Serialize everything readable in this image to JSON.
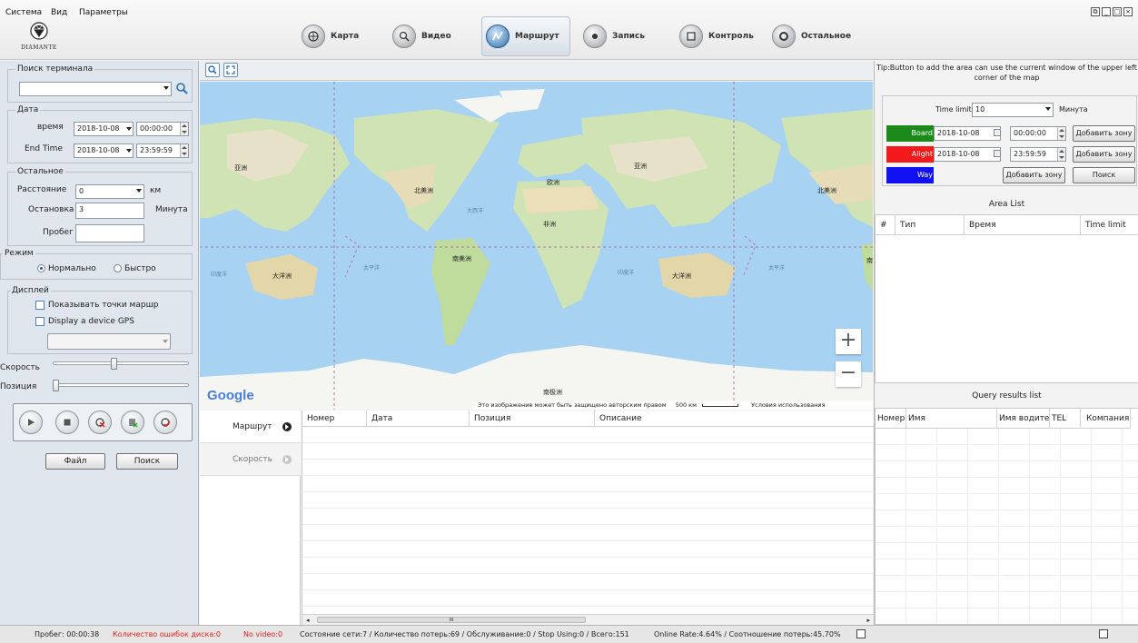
{
  "menu": [
    "Система",
    "Вид",
    "Параметры"
  ],
  "logo_text": "DIAMANTE",
  "nav_tabs": [
    {
      "label": "Карта",
      "icon": "map-icon"
    },
    {
      "label": "Видео",
      "icon": "video-icon"
    },
    {
      "label": "Маршрут",
      "icon": "route-icon",
      "active": true
    },
    {
      "label": "Запись",
      "icon": "record-icon"
    },
    {
      "label": "Контроль",
      "icon": "control-icon"
    },
    {
      "label": "Остальное",
      "icon": "other-icon"
    }
  ],
  "left": {
    "search_legend": "Поиск терминала",
    "search_value": "",
    "date_legend": "Дата",
    "start_time_label": "время",
    "start_date": "2018-10-08",
    "start_time": "00:00:00",
    "end_time_label": "End Time",
    "end_date": "2018-10-08",
    "end_time": "23:59:59",
    "other_legend": "Остальное",
    "distance_label": "Расстояние",
    "distance_value": "0",
    "distance_unit": "км",
    "stop_label": "Остановка",
    "stop_value": "3",
    "stop_unit": "Минута",
    "mileage_label": "Пробег",
    "mileage_value": "",
    "mode_legend": "Режим",
    "mode_normal": "Нормально",
    "mode_fast": "Быстро",
    "display_legend": "Дисплей",
    "show_route_points": "Показывать точки маршр",
    "display_gps": "Display a device GPS",
    "device_select": "",
    "speed_label": "Скорость",
    "speed_level": 0.45,
    "position_label": "Позиция",
    "position_level": 0.0,
    "file_button": "Файл",
    "search_button": "Поиск"
  },
  "map": {
    "google": "Google",
    "copyright": "Это изображение может быть защищено авторским правом",
    "scale": "500 км",
    "terms": "Условия использования",
    "labels": {
      "asia_w": "亚洲",
      "asia_e": "亚洲",
      "na_w": "北美洲",
      "na_e": "北美洲",
      "europe": "欧洲",
      "africa": "非洲",
      "sa": "南美洲",
      "oceania_w": "大洋洲",
      "oceania_e": "大洋洲",
      "antarctica": "南极洲",
      "atlantic": "大西洋",
      "pacific_w": "太平洋",
      "pacific_e": "太平洋",
      "indian_w": "印度洋",
      "indian_e": "印度洋",
      "sa_edge": "南"
    }
  },
  "subtabs": [
    "Маршрут",
    "Скорость"
  ],
  "route_table": {
    "columns": [
      "Номер",
      "Дата",
      "Позиция",
      "Описание"
    ],
    "rows": [],
    "scroll_mark": "III"
  },
  "right": {
    "tip": "Tip:Button to add the area can use the current window of the upper left corner of the map",
    "time_limit_label": "Time limit",
    "time_limit_value": "10",
    "time_limit_unit": "Минута",
    "board_label": "Board",
    "board_date": "2018-10-08",
    "board_time": "00:00:00",
    "alight_label": "Alight",
    "alight_date": "2018-10-08",
    "alight_time": "23:59:59",
    "way_label": "Way",
    "add_zone_button": "Добавить зону",
    "search_button": "Поиск",
    "board_color": "#1a8a1a",
    "alight_color": "#f21a1a",
    "way_color": "#1010f0",
    "area_list_title": "Area List",
    "area_columns": [
      "#",
      "Тип",
      "Время",
      "Time limit"
    ],
    "query_title": "Query results list",
    "query_columns": [
      "Номер",
      "Имя",
      "Имя водител",
      "TEL",
      "Компания"
    ]
  },
  "status": {
    "mileage": "Пробег: 00:00:38",
    "disk_errors": "Количество ошибок диска:0",
    "no_video": "No video:0",
    "network": "Состояние сети:7 / Количество потерь:69 / Обслуживание:0 / Stop Using:0 / Всего:151",
    "online": "Online Rate:4.64% / Соотношение потерь:45.70%",
    "error_color": "#e0201a"
  }
}
